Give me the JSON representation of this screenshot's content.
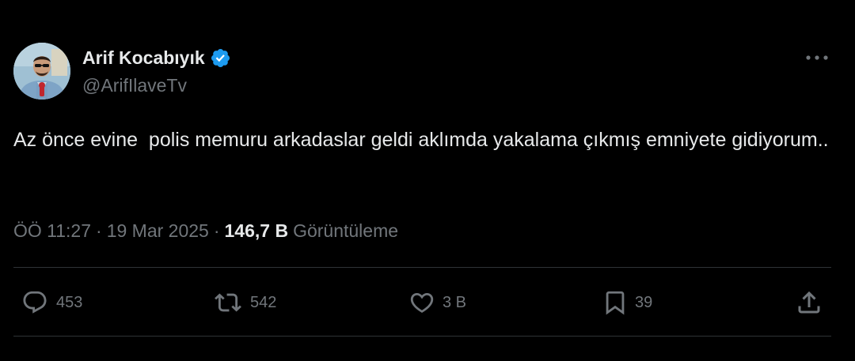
{
  "author": {
    "name": "Arif Kocabıyık",
    "handle": "@ArifIlaveTv",
    "verified": true,
    "verified_color": "#1d9bf0"
  },
  "tweet": {
    "text": "Az önce evine  polis memuru arkadaslar geldi aklımda yakalama çıkmış emniyete gidiyorum..",
    "time": "ÖÖ 11:27",
    "date": "19 Mar 2025",
    "separator": "·",
    "views_count": "146,7 B",
    "views_label": "Görüntüleme"
  },
  "actions": {
    "reply": {
      "icon": "reply-icon",
      "count": "453"
    },
    "retweet": {
      "icon": "retweet-icon",
      "count": "542"
    },
    "like": {
      "icon": "heart-icon",
      "count": "3 B"
    },
    "bookmark": {
      "icon": "bookmark-icon",
      "count": "39"
    },
    "share": {
      "icon": "share-icon"
    }
  },
  "icons": {
    "more": "more-horizontal-icon",
    "avatar": "avatar"
  },
  "colors": {
    "background": "#000000",
    "primary_text": "#e7e9ea",
    "secondary_text": "#71767b",
    "divider": "#2f3336",
    "accent": "#1d9bf0"
  }
}
